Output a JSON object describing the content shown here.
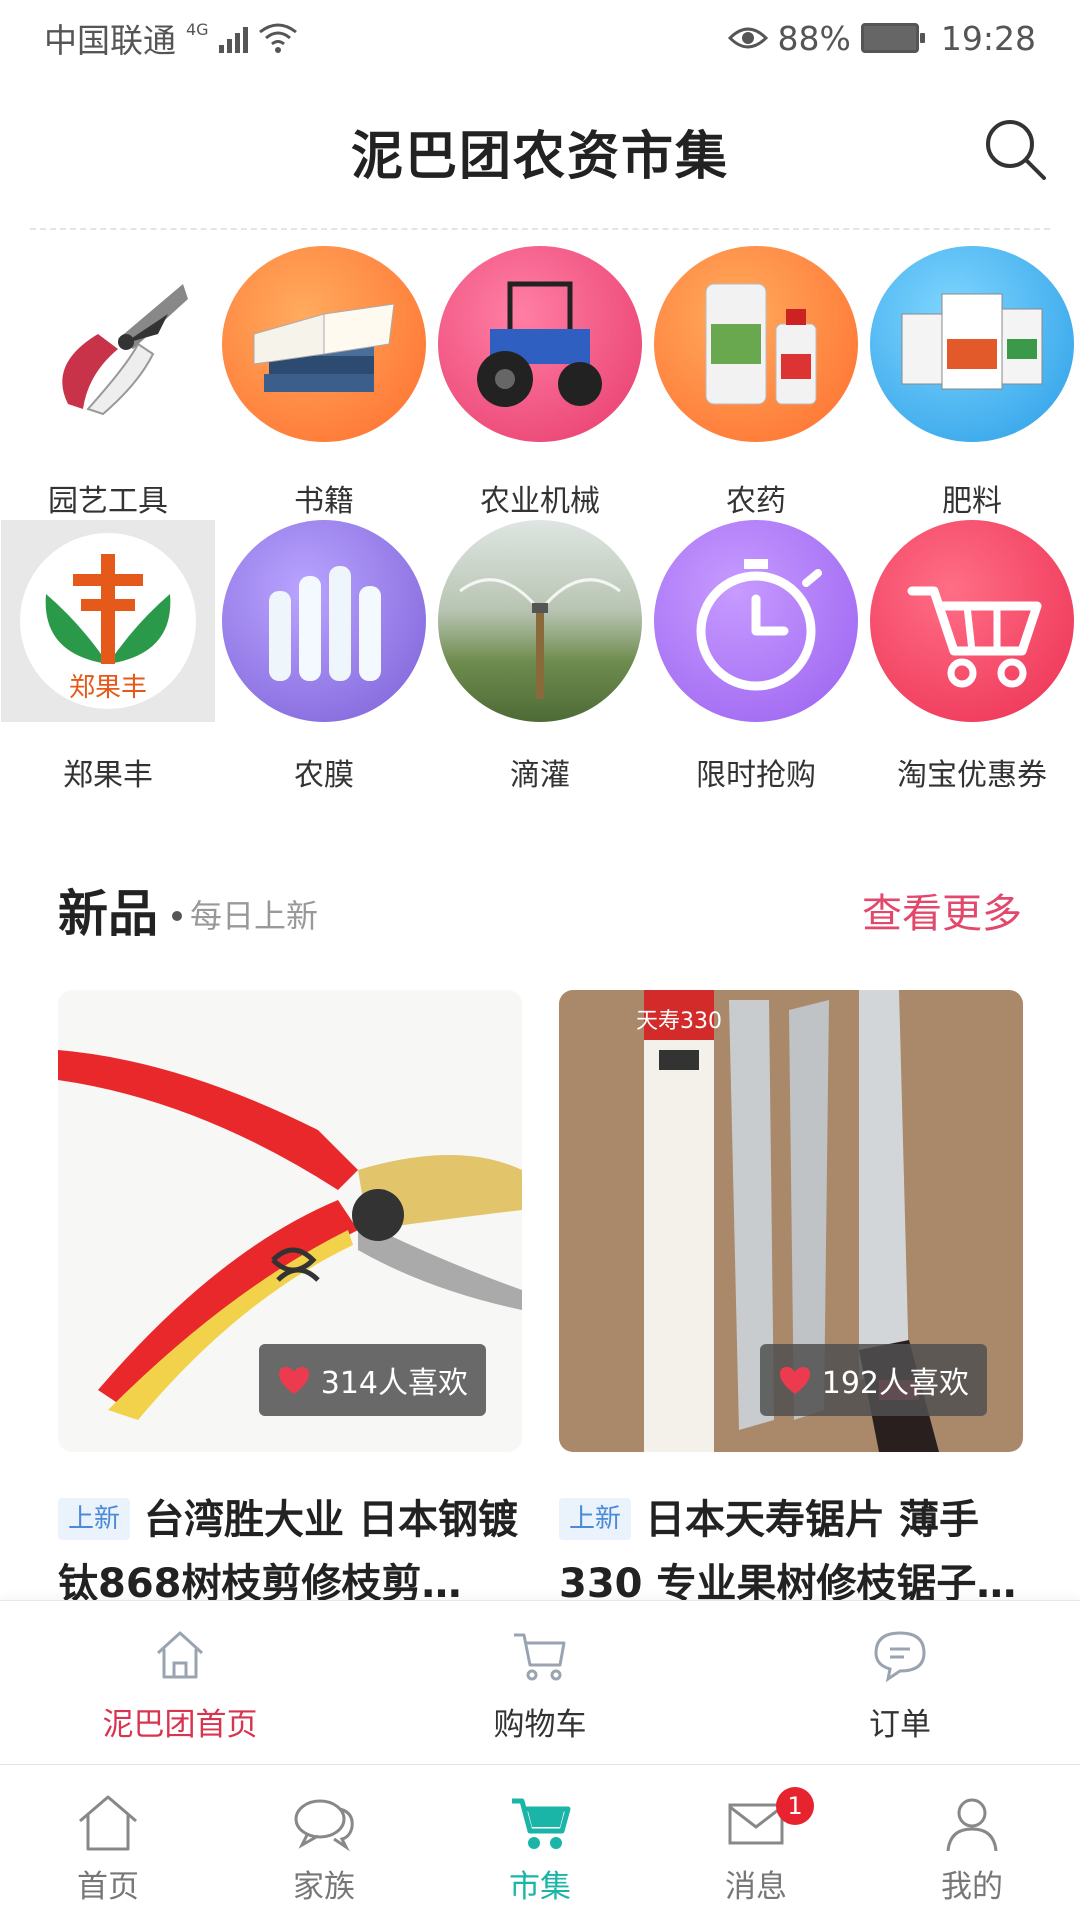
{
  "status_bar": {
    "carrier": "中国联通",
    "network": "4G",
    "battery_percent": "88%",
    "time": "19:28"
  },
  "header": {
    "title": "泥巴团农资市集",
    "search_icon": "search-icon"
  },
  "categories": [
    {
      "label": "园艺工具",
      "icon": "pruning-shears",
      "bg": "#ffffff"
    },
    {
      "label": "书籍",
      "icon": "books",
      "bg": "#ff8a3d"
    },
    {
      "label": "农业机械",
      "icon": "tractor",
      "bg": "#f0487a"
    },
    {
      "label": "农药",
      "icon": "pesticide-bottles",
      "bg": "#ff8a3d"
    },
    {
      "label": "肥料",
      "icon": "fertilizer-bags",
      "bg": "#3eb8f0"
    },
    {
      "label": "郑果丰",
      "icon": "zhengguofeng-logo",
      "bg": "#e8e8e8"
    },
    {
      "label": "农膜",
      "icon": "film-rolls",
      "bg": "#9a7ee6"
    },
    {
      "label": "滴灌",
      "icon": "sprinkler",
      "bg": "#8fa08a"
    },
    {
      "label": "限时抢购",
      "icon": "stopwatch",
      "bg": "#a56ef2"
    },
    {
      "label": "淘宝优惠券",
      "icon": "shopping-cart",
      "bg": "#f03c5c"
    }
  ],
  "logo_text": "郑果丰",
  "new_section": {
    "title": "新品",
    "subtitle": "每日上新",
    "more": "查看更多"
  },
  "products": [
    {
      "tag": "上新",
      "title": "台湾胜大业 日本钢镀钛868树枝剪修枝剪…",
      "likes": "314人喜欢"
    },
    {
      "tag": "上新",
      "title": "日本天寿锯片 薄手330 专业果树修枝锯子…",
      "likes": "192人喜欢",
      "package_text": "天寿330"
    }
  ],
  "sub_tabs": [
    {
      "label": "泥巴团首页",
      "icon": "home-outline-icon",
      "active": true
    },
    {
      "label": "购物车",
      "icon": "cart-outline-icon",
      "active": false
    },
    {
      "label": "订单",
      "icon": "chat-bubble-icon",
      "active": false
    }
  ],
  "tabs": [
    {
      "label": "首页",
      "icon": "home-icon",
      "active": false
    },
    {
      "label": "家族",
      "icon": "chat-icon",
      "active": false
    },
    {
      "label": "市集",
      "icon": "cart-icon",
      "active": true
    },
    {
      "label": "消息",
      "icon": "mail-icon",
      "active": false,
      "badge": "1"
    },
    {
      "label": "我的",
      "icon": "user-icon",
      "active": false
    }
  ],
  "colors": {
    "accent_pink": "#e2486b",
    "active_tab": "#1bb5a8",
    "active_subtab": "#d8344f",
    "badge_red": "#e7232f",
    "tag_blue": "#4a8ad8"
  }
}
